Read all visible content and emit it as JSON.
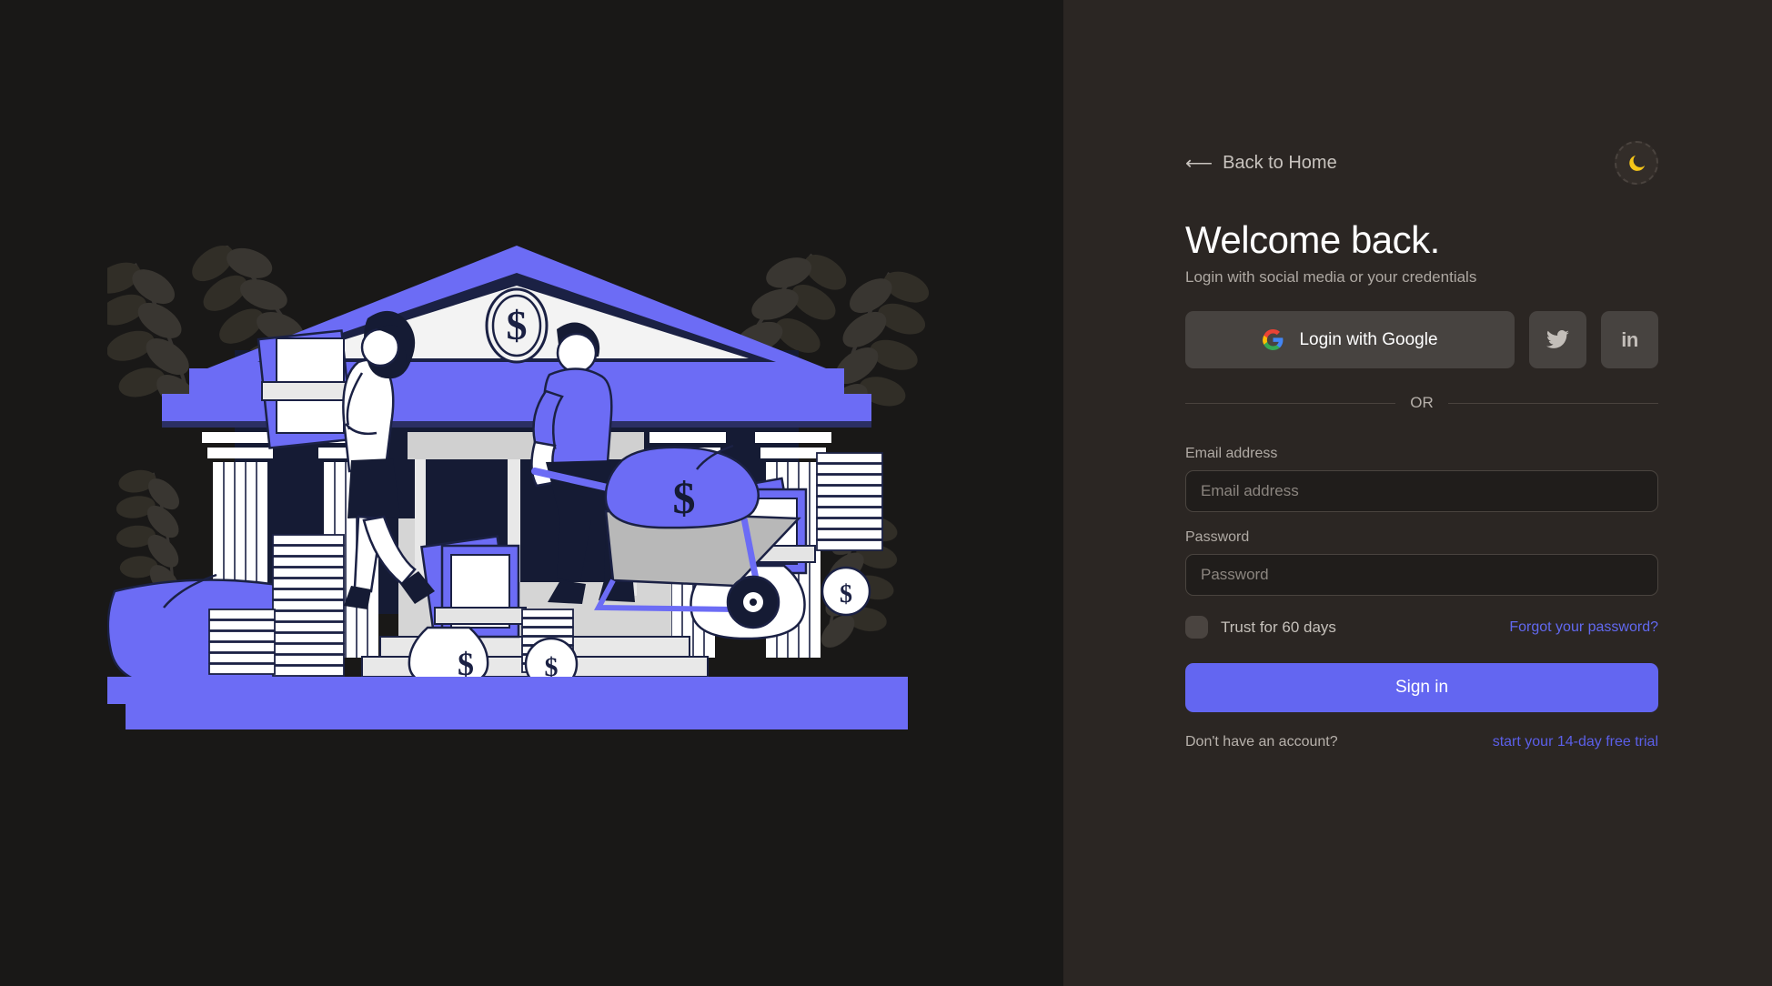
{
  "theme": {
    "accent": "#6366F1",
    "left_bg": "#191817",
    "right_bg": "#2B2623",
    "button_bg": "#474340",
    "moon_color": "#F5C518"
  },
  "header": {
    "back_label": "Back to Home",
    "back_arrow": "⟵",
    "theme_toggle_icon": "moon-icon"
  },
  "main": {
    "title": "Welcome back.",
    "subtitle": "Login with social media or your credentials"
  },
  "social": {
    "google_label": "Login with Google",
    "google_icon": "google-logo-icon",
    "twitter_icon": "twitter-icon",
    "linkedin_label": "in",
    "linkedin_icon": "linkedin-icon"
  },
  "divider": {
    "text": "OR"
  },
  "form": {
    "email": {
      "label": "Email address",
      "placeholder": "Email address",
      "value": ""
    },
    "password": {
      "label": "Password",
      "placeholder": "Password",
      "value": ""
    },
    "trust_label": "Trust for 60 days",
    "trust_checked": false,
    "forgot_label": "Forgot your password?",
    "submit_label": "Sign in"
  },
  "footer": {
    "prompt": "Don't have an account?",
    "link": "start your 14-day free trial"
  },
  "illustration": {
    "name": "bank-money-illustration",
    "description": "Bank building with columns, dollar emblem on pediment, woman carrying banknotes, man pushing wheelbarrow with money bag, money bags, coin stacks, and leaf plants"
  }
}
